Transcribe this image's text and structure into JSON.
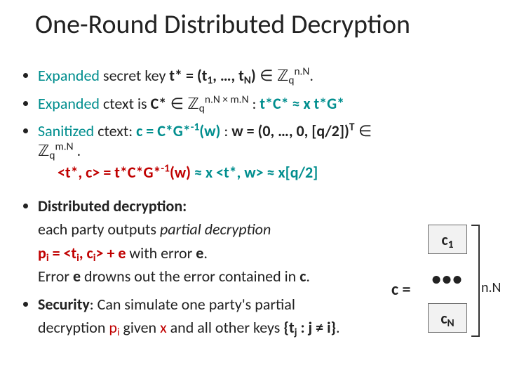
{
  "title": "One-Round Distributed Decryption",
  "bullets": {
    "b1": {
      "lead": "Expanded",
      "text1": " secret key ",
      "key": "t* = (t",
      "key_sub1": "1",
      "key_mid": ", …, t",
      "key_subN": "N",
      "key_close": ")",
      "in_word": " ∈ ",
      "ring": "ℤ",
      "ring_sub": "q",
      "ring_sup": "n.N",
      "dot": "."
    },
    "b2": {
      "lead": "Expanded",
      "text1": " ctext is ",
      "C": "C*",
      "in_word": " ∈ ",
      "ring": "ℤ",
      "ring_sub": "q",
      "ring_sup": "n.N × m.N",
      "colon": "  :  ",
      "rel": "t*C* ≈ x t*G*"
    },
    "b3": {
      "lead": "Sanitized",
      "text1": " ctext:   ",
      "eq1": "c = C*G*",
      "eq1_sup": "-1",
      "eq1_tail": "(w)",
      "colon": "   :   ",
      "wdef_pre": "w = (0, …, 0, [q/2])",
      "wdef_sup": "T",
      "in_word": " ∈ ",
      "ring": "ℤ",
      "ring_sub": "q",
      "ring_sup": "m.N",
      "dot": " .",
      "line2_a": "<t*, c> = t*C*G*",
      "line2_a_sup": "-1",
      "line2_a_tail": "(w)",
      "line2_b": " ≈ x <t*, w> ≈  x[q/2]"
    },
    "b4": {
      "title": "Distributed decryption:",
      "sub1": "each party outputs ",
      "sub1_i": "partial decryption",
      "eq_pre": "p",
      "eq_sub": "i",
      "eq_mid": " = <t",
      "eq_sub2": "i",
      "eq_mid2": ", c",
      "eq_sub3": "i",
      "eq_tail": "> + e",
      "eq_after": "   with error ",
      "e": "e",
      "dot": ".",
      "err_line_a": "Error ",
      "err_line_e": "e",
      "err_line_b": " drowns out the error contained in ",
      "err_line_c": "c",
      "err_line_dot": "."
    },
    "b5": {
      "title": "Security",
      "title_after": ": Can simulate one party's partial",
      "sub_a": "decryption ",
      "sub_p": "p",
      "sub_p_sub": "i",
      "sub_b": " given ",
      "sub_x": "x",
      "sub_c": " and all other keys ",
      "set_open": "{t",
      "set_sub": "j",
      "set_mid": " : j ≠ i}",
      "dot": "."
    }
  },
  "diagram": {
    "c_eq": "c =",
    "c1": "c",
    "c1_sub": "1",
    "dots": "•••",
    "cN": "c",
    "cN_sub": "N",
    "nN": "n.N"
  }
}
